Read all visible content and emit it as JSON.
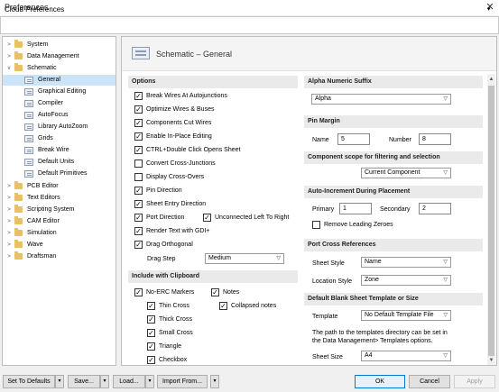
{
  "window": {
    "title": "Preferences",
    "close": "✕"
  },
  "cloud": {
    "label": "Cloud Preferences",
    "arrow": "▾"
  },
  "tree": {
    "system": "System",
    "data_management": "Data Management",
    "schematic": "Schematic",
    "general": "General",
    "graphical_editing": "Graphical Editing",
    "compiler": "Compiler",
    "autofocus": "AutoFocus",
    "library_autozoom": "Library AutoZoom",
    "grids": "Grids",
    "break_wire": "Break Wire",
    "default_units": "Default Units",
    "default_primitives": "Default Primitives",
    "pcb_editor": "PCB Editor",
    "text_editors": "Text Editors",
    "scripting_system": "Scripting System",
    "cam_editor": "CAM Editor",
    "simulation": "Simulation",
    "wave": "Wave",
    "draftsman": "Draftsman"
  },
  "header": {
    "title": "Schematic – General"
  },
  "options": {
    "heading": "Options",
    "break_wires": "Break Wires At Autojunctions",
    "optimize": "Optimize Wires & Buses",
    "components_cut": "Components Cut Wires",
    "inplace": "Enable In-Place Editing",
    "ctrl_dbl": "CTRL+Double Click Opens Sheet",
    "convert_cross": "Convert Cross-Junctions",
    "display_cross": "Display Cross-Overs",
    "pin_direction": "Pin Direction",
    "sheet_entry": "Sheet Entry Direction",
    "port_direction": "Port Direction",
    "unconnected": "Unconnected Left To Right",
    "render_gdi": "Render Text with GDI+",
    "drag_orth": "Drag Orthogonal",
    "drag_step_label": "Drag Step",
    "drag_step_value": "Medium"
  },
  "clipboard": {
    "heading": "Include with Clipboard",
    "no_erc": "No-ERC Markers",
    "notes": "Notes",
    "thin_cross": "Thin Cross",
    "collapsed_notes": "Collapsed notes",
    "thick_cross": "Thick Cross",
    "small_cross": "Small Cross",
    "triangle": "Triangle",
    "checkbox": "Checkbox"
  },
  "alpha": {
    "heading": "Alpha Numeric Suffix",
    "value": "Alpha"
  },
  "pin_margin": {
    "heading": "Pin Margin",
    "name_label": "Name",
    "name_value": "5",
    "number_label": "Number",
    "number_value": "8"
  },
  "scope": {
    "heading": "Component scope for filtering and selection",
    "value": "Current Component"
  },
  "auto_inc": {
    "heading": "Auto-Increment During Placement",
    "primary_label": "Primary",
    "primary_value": "1",
    "secondary_label": "Secondary",
    "secondary_value": "2",
    "remove_zeroes": "Remove Leading Zeroes"
  },
  "port_cross": {
    "heading": "Port Cross References",
    "sheet_style_label": "Sheet Style",
    "sheet_style_value": "Name",
    "location_style_label": "Location Style",
    "location_style_value": "Zone"
  },
  "blank_sheet": {
    "heading": "Default Blank Sheet Template or Size",
    "template_label": "Template",
    "template_value": "No Default Template File",
    "path_note_1": "The path to the templates directory can be set in",
    "path_note_2": "the Data Management> Templates options.",
    "sheet_size_label": "Sheet Size",
    "sheet_size_value": "A4"
  },
  "footer": {
    "set_defaults": "Set To Defaults",
    "save": "Save...",
    "load": "Load...",
    "import_from": "Import From...",
    "ok": "OK",
    "cancel": "Cancel",
    "apply": "Apply"
  }
}
